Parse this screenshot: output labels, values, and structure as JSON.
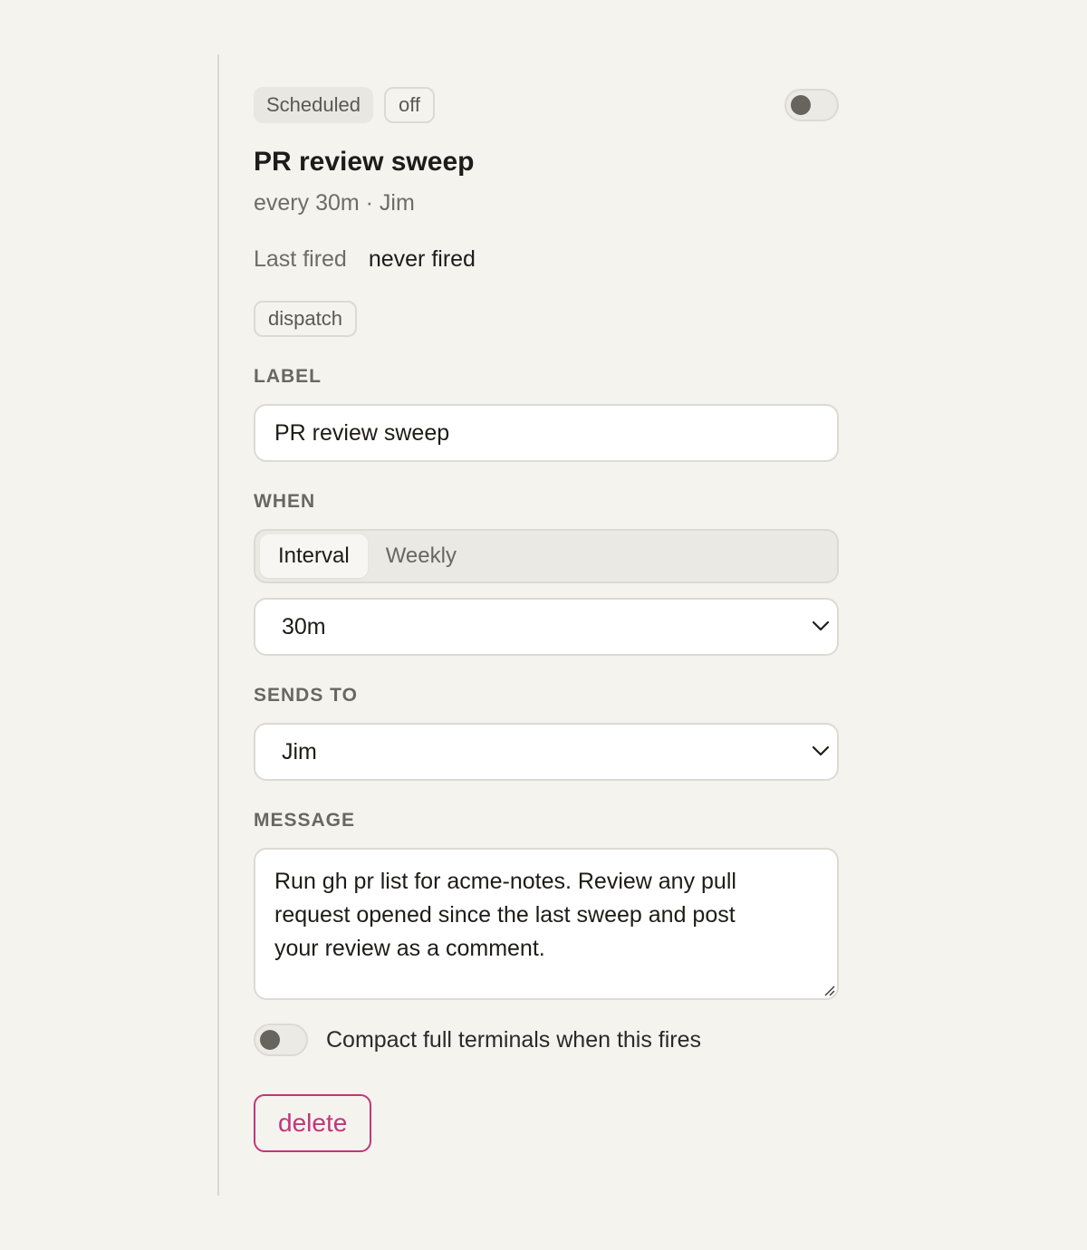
{
  "header": {
    "kind_badge": "Scheduled",
    "state_badge": "off",
    "title": "PR review sweep",
    "subtitle": "every 30m · Jim",
    "last_fired_label": "Last fired",
    "last_fired_value": "never fired",
    "action_chip": "dispatch",
    "enabled": false
  },
  "form": {
    "label_heading": "LABEL",
    "label_value": "PR review sweep",
    "when_heading": "WHEN",
    "when_tabs": [
      {
        "label": "Interval",
        "active": true
      },
      {
        "label": "Weekly",
        "active": false
      }
    ],
    "interval_value": "30m",
    "sends_to_heading": "SENDS TO",
    "sends_to_value": "Jim",
    "message_heading": "MESSAGE",
    "message_value": "Run gh pr list for acme-notes. Review any pull request opened since the last sweep and post your review as a comment.",
    "compact_toggle_on": false,
    "compact_label": "Compact full terminals when this fires",
    "delete_label": "delete"
  },
  "colors": {
    "background": "#f4f3ee",
    "danger": "#c2367a",
    "toggle_knob": "#67645e"
  },
  "icons": {
    "select_chevron": "chevron-down-icon",
    "textarea_grip": "resize-grip-icon"
  }
}
